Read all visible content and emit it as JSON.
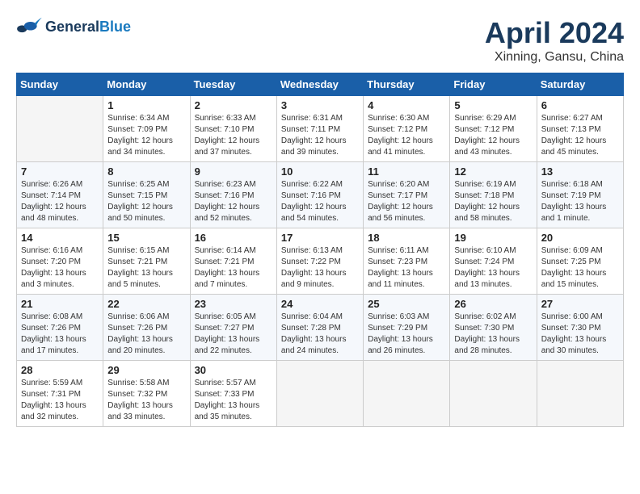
{
  "header": {
    "logo_line1": "General",
    "logo_line2": "Blue",
    "month": "April 2024",
    "location": "Xinning, Gansu, China"
  },
  "weekdays": [
    "Sunday",
    "Monday",
    "Tuesday",
    "Wednesday",
    "Thursday",
    "Friday",
    "Saturday"
  ],
  "weeks": [
    [
      {
        "day": "",
        "empty": true
      },
      {
        "day": "1",
        "sunrise": "6:34 AM",
        "sunset": "7:09 PM",
        "daylight": "12 hours and 34 minutes."
      },
      {
        "day": "2",
        "sunrise": "6:33 AM",
        "sunset": "7:10 PM",
        "daylight": "12 hours and 37 minutes."
      },
      {
        "day": "3",
        "sunrise": "6:31 AM",
        "sunset": "7:11 PM",
        "daylight": "12 hours and 39 minutes."
      },
      {
        "day": "4",
        "sunrise": "6:30 AM",
        "sunset": "7:12 PM",
        "daylight": "12 hours and 41 minutes."
      },
      {
        "day": "5",
        "sunrise": "6:29 AM",
        "sunset": "7:12 PM",
        "daylight": "12 hours and 43 minutes."
      },
      {
        "day": "6",
        "sunrise": "6:27 AM",
        "sunset": "7:13 PM",
        "daylight": "12 hours and 45 minutes."
      }
    ],
    [
      {
        "day": "7",
        "sunrise": "6:26 AM",
        "sunset": "7:14 PM",
        "daylight": "12 hours and 48 minutes."
      },
      {
        "day": "8",
        "sunrise": "6:25 AM",
        "sunset": "7:15 PM",
        "daylight": "12 hours and 50 minutes."
      },
      {
        "day": "9",
        "sunrise": "6:23 AM",
        "sunset": "7:16 PM",
        "daylight": "12 hours and 52 minutes."
      },
      {
        "day": "10",
        "sunrise": "6:22 AM",
        "sunset": "7:16 PM",
        "daylight": "12 hours and 54 minutes."
      },
      {
        "day": "11",
        "sunrise": "6:20 AM",
        "sunset": "7:17 PM",
        "daylight": "12 hours and 56 minutes."
      },
      {
        "day": "12",
        "sunrise": "6:19 AM",
        "sunset": "7:18 PM",
        "daylight": "12 hours and 58 minutes."
      },
      {
        "day": "13",
        "sunrise": "6:18 AM",
        "sunset": "7:19 PM",
        "daylight": "13 hours and 1 minute."
      }
    ],
    [
      {
        "day": "14",
        "sunrise": "6:16 AM",
        "sunset": "7:20 PM",
        "daylight": "13 hours and 3 minutes."
      },
      {
        "day": "15",
        "sunrise": "6:15 AM",
        "sunset": "7:21 PM",
        "daylight": "13 hours and 5 minutes."
      },
      {
        "day": "16",
        "sunrise": "6:14 AM",
        "sunset": "7:21 PM",
        "daylight": "13 hours and 7 minutes."
      },
      {
        "day": "17",
        "sunrise": "6:13 AM",
        "sunset": "7:22 PM",
        "daylight": "13 hours and 9 minutes."
      },
      {
        "day": "18",
        "sunrise": "6:11 AM",
        "sunset": "7:23 PM",
        "daylight": "13 hours and 11 minutes."
      },
      {
        "day": "19",
        "sunrise": "6:10 AM",
        "sunset": "7:24 PM",
        "daylight": "13 hours and 13 minutes."
      },
      {
        "day": "20",
        "sunrise": "6:09 AM",
        "sunset": "7:25 PM",
        "daylight": "13 hours and 15 minutes."
      }
    ],
    [
      {
        "day": "21",
        "sunrise": "6:08 AM",
        "sunset": "7:26 PM",
        "daylight": "13 hours and 17 minutes."
      },
      {
        "day": "22",
        "sunrise": "6:06 AM",
        "sunset": "7:26 PM",
        "daylight": "13 hours and 20 minutes."
      },
      {
        "day": "23",
        "sunrise": "6:05 AM",
        "sunset": "7:27 PM",
        "daylight": "13 hours and 22 minutes."
      },
      {
        "day": "24",
        "sunrise": "6:04 AM",
        "sunset": "7:28 PM",
        "daylight": "13 hours and 24 minutes."
      },
      {
        "day": "25",
        "sunrise": "6:03 AM",
        "sunset": "7:29 PM",
        "daylight": "13 hours and 26 minutes."
      },
      {
        "day": "26",
        "sunrise": "6:02 AM",
        "sunset": "7:30 PM",
        "daylight": "13 hours and 28 minutes."
      },
      {
        "day": "27",
        "sunrise": "6:00 AM",
        "sunset": "7:30 PM",
        "daylight": "13 hours and 30 minutes."
      }
    ],
    [
      {
        "day": "28",
        "sunrise": "5:59 AM",
        "sunset": "7:31 PM",
        "daylight": "13 hours and 32 minutes."
      },
      {
        "day": "29",
        "sunrise": "5:58 AM",
        "sunset": "7:32 PM",
        "daylight": "13 hours and 33 minutes."
      },
      {
        "day": "30",
        "sunrise": "5:57 AM",
        "sunset": "7:33 PM",
        "daylight": "13 hours and 35 minutes."
      },
      {
        "day": "",
        "empty": true
      },
      {
        "day": "",
        "empty": true
      },
      {
        "day": "",
        "empty": true
      },
      {
        "day": "",
        "empty": true
      }
    ]
  ],
  "labels": {
    "sunrise": "Sunrise:",
    "sunset": "Sunset:",
    "daylight": "Daylight:"
  }
}
